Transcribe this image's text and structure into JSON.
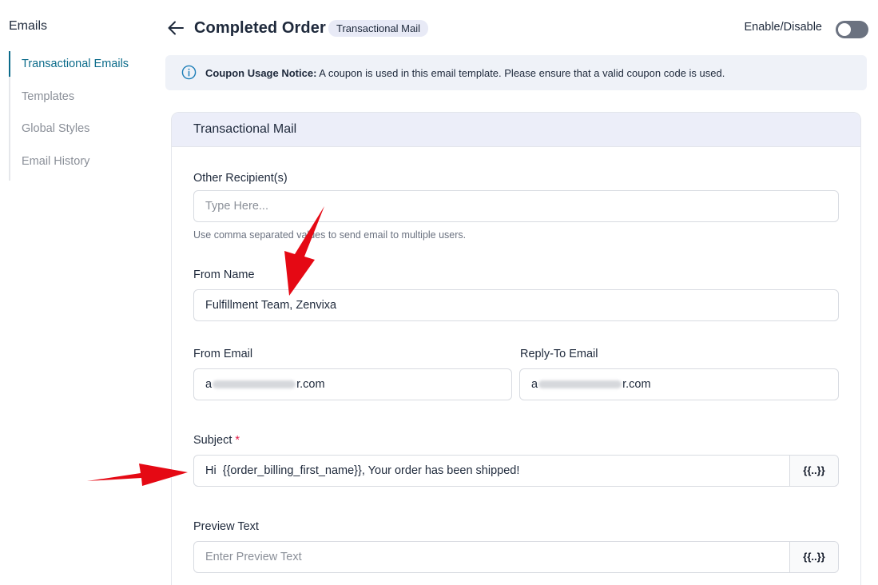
{
  "sidebar": {
    "title": "Emails",
    "items": [
      {
        "label": "Transactional Emails",
        "active": true
      },
      {
        "label": "Templates"
      },
      {
        "label": "Global Styles"
      },
      {
        "label": "Email History"
      }
    ]
  },
  "header": {
    "title": "Completed Order",
    "badge": "Transactional Mail",
    "enable_label": "Enable/Disable",
    "toggle_state": "off"
  },
  "notice": {
    "bold": "Coupon Usage Notice:",
    "text": " A coupon is used in this email template. Please ensure that a valid coupon code is used."
  },
  "card": {
    "title": "Transactional Mail",
    "other_recipients": {
      "label": "Other Recipient(s)",
      "placeholder": "Type Here...",
      "value": "",
      "help": "Use comma separated values to send email to multiple users."
    },
    "from_name": {
      "label": "From Name",
      "value": "Fulfillment Team, Zenvixa"
    },
    "from_email": {
      "label": "From Email",
      "prefix": "a",
      "suffix": "r.com"
    },
    "reply_to": {
      "label": "Reply-To Email",
      "prefix": "a",
      "suffix": "r.com"
    },
    "subject": {
      "label": "Subject",
      "required_mark": "*",
      "value": "Hi  {{order_billing_first_name}}, Your order has been shipped!",
      "tag_button": "{{..}}"
    },
    "preview_text": {
      "label": "Preview Text",
      "placeholder": "Enter Preview Text",
      "value": "",
      "tag_button": "{{..}}"
    }
  },
  "colors": {
    "accent": "#0b6b8a",
    "annotation_arrow": "#e50914",
    "card_header_bg": "#eceef9",
    "notice_bg": "#eff2f8"
  }
}
